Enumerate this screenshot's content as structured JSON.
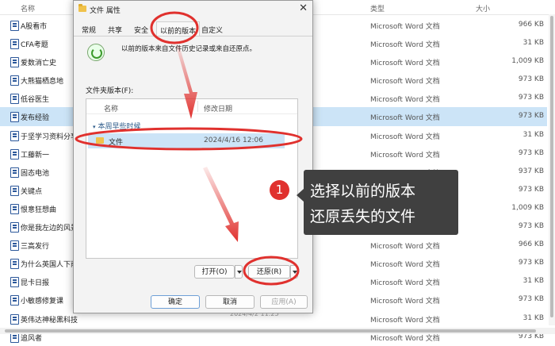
{
  "explorer": {
    "columns": {
      "name": "名称",
      "type": "类型",
      "size": "大小"
    },
    "rows": [
      {
        "name": "A股看市",
        "type": "Microsoft Word 文档",
        "size": "966 KB"
      },
      {
        "name": "CFA考题",
        "type": "Microsoft Word 文档",
        "size": "31 KB"
      },
      {
        "name": "爱数消亡史",
        "type": "Microsoft Word 文档",
        "size": "1,009 KB"
      },
      {
        "name": "大熊猫栖息地",
        "type": "Microsoft Word 文档",
        "size": "973 KB"
      },
      {
        "name": "低谷医生",
        "type": "Microsoft Word 文档",
        "size": "973 KB"
      },
      {
        "name": "发布经验",
        "type": "Microsoft Word 文档",
        "size": "973 KB",
        "selected": true
      },
      {
        "name": "于坚学习资料分享",
        "type": "Microsoft Word 文档",
        "size": "31 KB"
      },
      {
        "name": "工藤新一",
        "type": "Microsoft Word 文档",
        "size": "973 KB"
      },
      {
        "name": "固态电池",
        "type": "Microsoft Word 文档",
        "size": "937 KB"
      },
      {
        "name": "关键点",
        "type": "Microsoft Word 文档",
        "size": "973 KB"
      },
      {
        "name": "恨意狂想曲",
        "type": "Microsoft Word 文档",
        "size": "1,009 KB"
      },
      {
        "name": "你是我左边的风景",
        "type": "Microsoft Word 文档",
        "size": "973 KB"
      },
      {
        "name": "三高发行",
        "type": "Microsoft Word 文档",
        "size": "966 KB"
      },
      {
        "name": "为什么英国人下雨",
        "type": "Microsoft Word 文档",
        "size": "973 KB"
      },
      {
        "name": "昆卡日报",
        "type": "Microsoft Word 文档",
        "size": "31 KB"
      },
      {
        "name": "小敏感修复课",
        "type": "Microsoft Word 文档",
        "size": "973 KB"
      },
      {
        "name": "英伟达神秘黑科技",
        "type": "Microsoft Word 文档",
        "size": "31 KB"
      },
      {
        "name": "追风者",
        "type": "Microsoft Word 文档",
        "size": "973 KB"
      }
    ],
    "bottom_date": "2024/4/2 11:25"
  },
  "dialog": {
    "title": "文件 属性",
    "close": "✕",
    "tabs": [
      "常规",
      "共享",
      "安全",
      "以前的版本",
      "自定义"
    ],
    "active_tab": 3,
    "description": "以前的版本来自文件历史记录或来自还原点。",
    "folder_versions_label": "文件夹版本(F):",
    "list_headers": {
      "name": "名称",
      "date": "修改日期"
    },
    "group_label": "本周早些时候",
    "entry": {
      "name": "文件",
      "date": "2024/4/16 12:06"
    },
    "buttons": {
      "open": "打开(O)",
      "restore": "还原(R)",
      "ok": "确定",
      "cancel": "取消",
      "apply": "应用(A)"
    }
  },
  "annotation": {
    "step": "1",
    "line1": "选择以前的版本",
    "line2": "还原丢失的文件",
    "color": "#e0312e"
  }
}
